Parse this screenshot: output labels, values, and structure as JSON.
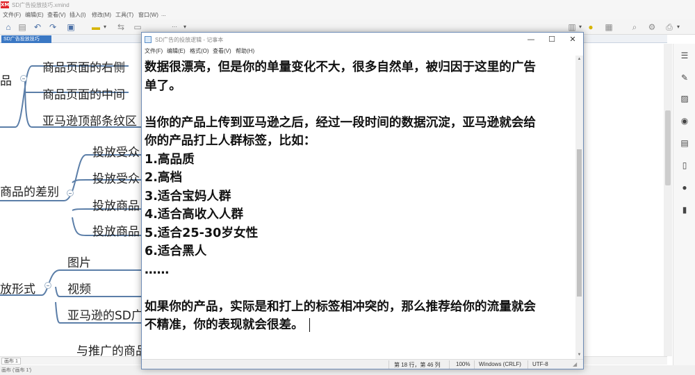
{
  "xmind": {
    "title": "SD广告投放技巧.xmind",
    "menu": [
      "文件(F)",
      "编辑(E)",
      "查看(V)",
      "插入(I)",
      "修改(M)",
      "工具(T)",
      "窗口(W)",
      "..."
    ],
    "doc_tab": "SD广告投放技巧",
    "sheet_tab": "画布 1",
    "status_text": "画布 ('画布 1')",
    "topics": {
      "group1_parent": "品",
      "group1_children": [
        "商品页面的右侧",
        "商品页面的中间",
        "亚马逊顶部条纹区"
      ],
      "group2_parent": "商品的差别",
      "group2_children": [
        "投放受众",
        "投放受众",
        "投放商品",
        "投放商品"
      ],
      "group3_parent": "放形式",
      "group3_children": [
        "图片",
        "视频",
        "亚马逊的SD广"
      ],
      "partial_bottom": "与推广的商品"
    }
  },
  "notepad": {
    "title": "SD广告的投放逻辑 - 记事本",
    "menu": [
      "文件(F)",
      "编辑(E)",
      "格式(O)",
      "查看(V)",
      "帮助(H)"
    ],
    "lines": [
      "数据很漂亮，但是你的单量变化不大，很多自然单，被归因于这里的广告",
      "单了。",
      "",
      "当你的产品上传到亚马逊之后，经过一段时间的数据沉淀，亚马逊就会给",
      "你的产品打上人群标签，比如：",
      "1.高品质",
      "2.高档",
      "3.适合宝妈人群",
      "4.适合高收入人群",
      "5.适合25-30岁女性",
      "6.适合黑人",
      "……",
      "",
      "如果你的产品，实际是和打上的标签相冲突的，那么推荐给你的流量就会",
      "不精准，你的表现就会很差。"
    ],
    "status": {
      "position": "第 18 行，第 46 列",
      "zoom": "100%",
      "line_ending": "Windows (CRLF)",
      "encoding": "UTF-8"
    },
    "controls": {
      "minimize": "—",
      "maximize": "☐",
      "close": "✕"
    }
  },
  "colors": {
    "branch_line": "#5b7ea8",
    "accent": "#3b78c4",
    "logo": "#e0242a"
  }
}
